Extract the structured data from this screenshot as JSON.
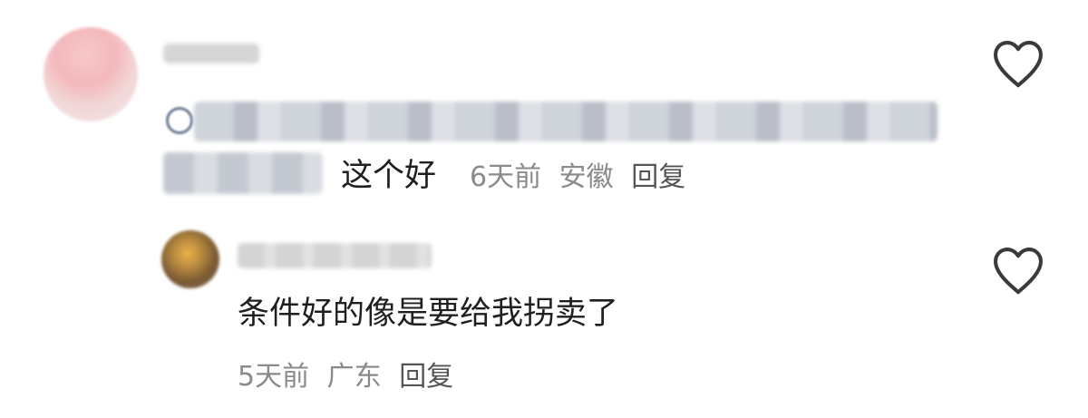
{
  "comments": [
    {
      "text": "这个好",
      "time": "6天前",
      "location": "安徽",
      "reply_label": "回复",
      "icon": "heart-outline-icon"
    },
    {
      "text": "条件好的像是要给我拐卖了",
      "time": "5天前",
      "location": "广东",
      "reply_label": "回复",
      "icon": "heart-outline-icon"
    }
  ],
  "colors": {
    "text": "#1f1f1f",
    "meta": "#8a8a8a",
    "icon": "#3a3a3a",
    "avatar1": "#f3b9bd",
    "avatar2": "#8a6a3c"
  }
}
